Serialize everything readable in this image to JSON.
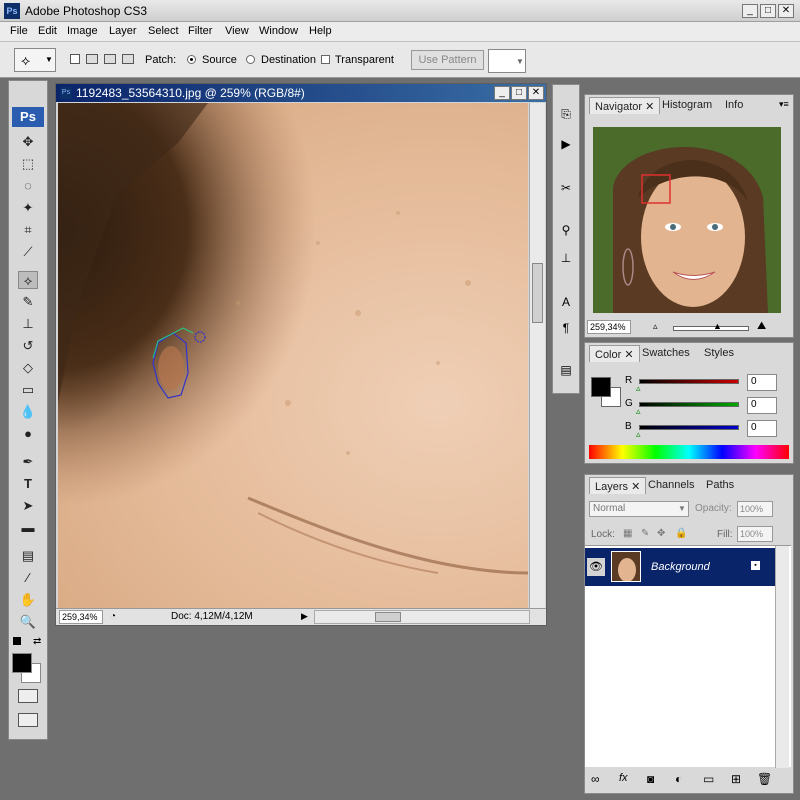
{
  "app": {
    "title": "Adobe Photoshop CS3",
    "logo": "Ps"
  },
  "menu": [
    "File",
    "Edit",
    "Image",
    "Layer",
    "Select",
    "Filter",
    "View",
    "Window",
    "Help"
  ],
  "options": {
    "patch_label": "Patch:",
    "source_label": "Source",
    "destination_label": "Destination",
    "transparent_label": "Transparent",
    "use_pattern_label": "Use Pattern",
    "mode": "Source"
  },
  "document": {
    "title": "1192483_53564310.jpg @ 259% (RGB/8#)",
    "zoom": "259,34%",
    "doc_info": "Doc: 4,12M/4,12M"
  },
  "navigator": {
    "tabs": [
      "Navigator",
      "Histogram",
      "Info"
    ],
    "zoom": "259,34%"
  },
  "color": {
    "tabs": [
      "Color",
      "Swatches",
      "Styles"
    ],
    "channels": [
      {
        "label": "R",
        "value": "0",
        "color": "#cc0000"
      },
      {
        "label": "G",
        "value": "0",
        "color": "#00aa00"
      },
      {
        "label": "B",
        "value": "0",
        "color": "#0000cc"
      }
    ]
  },
  "layers": {
    "tabs": [
      "Layers",
      "Channels",
      "Paths"
    ],
    "blend_mode": "Normal",
    "opacity_label": "Opacity:",
    "opacity": "100%",
    "lock_label": "Lock:",
    "fill_label": "Fill:",
    "fill": "100%",
    "items": [
      {
        "name": "Background"
      }
    ]
  },
  "colors": {
    "accent": "#0a246a",
    "selection": "#0a246a"
  }
}
